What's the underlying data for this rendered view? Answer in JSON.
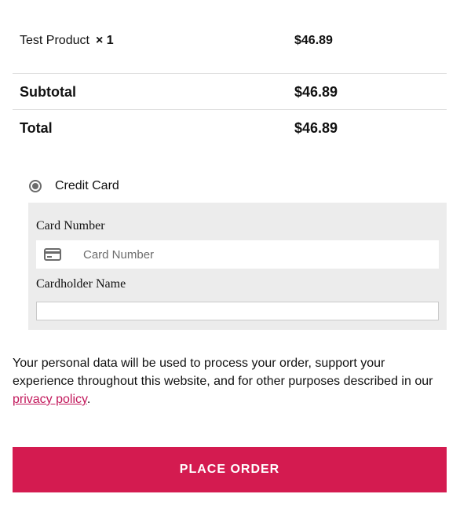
{
  "order": {
    "product_name": "Test Product",
    "product_qty": "× 1",
    "product_price": "$46.89",
    "subtotal_label": "Subtotal",
    "subtotal_value": "$46.89",
    "total_label": "Total",
    "total_value": "$46.89"
  },
  "payment": {
    "method_label": "Credit Card",
    "card_number_label": "Card Number",
    "card_number_placeholder": "Card Number",
    "card_number_value": "",
    "cardholder_label": "Cardholder Name",
    "cardholder_value": "",
    "card_icon": "credit-card-icon"
  },
  "privacy": {
    "text_before": "Your personal data will be used to process your order, support your experience throughout this website, and for other purposes described in our ",
    "link_text": "privacy policy",
    "text_after": "."
  },
  "actions": {
    "place_order_label": "PLACE ORDER"
  },
  "colors": {
    "accent": "#d41b50",
    "link": "#c2185b",
    "panel_bg": "#ececec"
  }
}
